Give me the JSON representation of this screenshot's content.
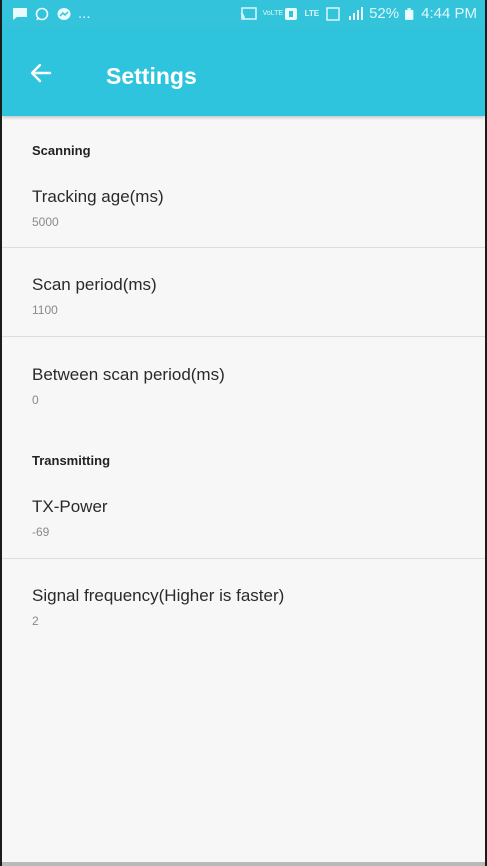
{
  "status_bar": {
    "ellipsis": "...",
    "battery": "52%",
    "time": "4:44 PM",
    "volte_label": "VoLTE",
    "lte_label": "LTE"
  },
  "appbar": {
    "title": "Settings",
    "background": "#2fc4dd"
  },
  "sections": [
    {
      "header": "Scanning",
      "items": [
        {
          "title": "Tracking age(ms)",
          "summary": "5000"
        },
        {
          "title": "Scan period(ms)",
          "summary": "1100"
        },
        {
          "title": "Between scan period(ms)",
          "summary": "0"
        }
      ]
    },
    {
      "header": "Transmitting",
      "items": [
        {
          "title": "TX-Power",
          "summary": "-69"
        },
        {
          "title": "Signal frequency(Higher is faster)",
          "summary": "2"
        }
      ]
    }
  ],
  "icons": {
    "back": "arrow-left-icon",
    "status_left": [
      "message-icon",
      "whatsapp-icon",
      "messenger-icon"
    ],
    "status_right": [
      "cast-icon",
      "volte-icon",
      "nfc-icon",
      "lte-icon",
      "sim-icon",
      "signal-icon",
      "battery-icon"
    ]
  }
}
